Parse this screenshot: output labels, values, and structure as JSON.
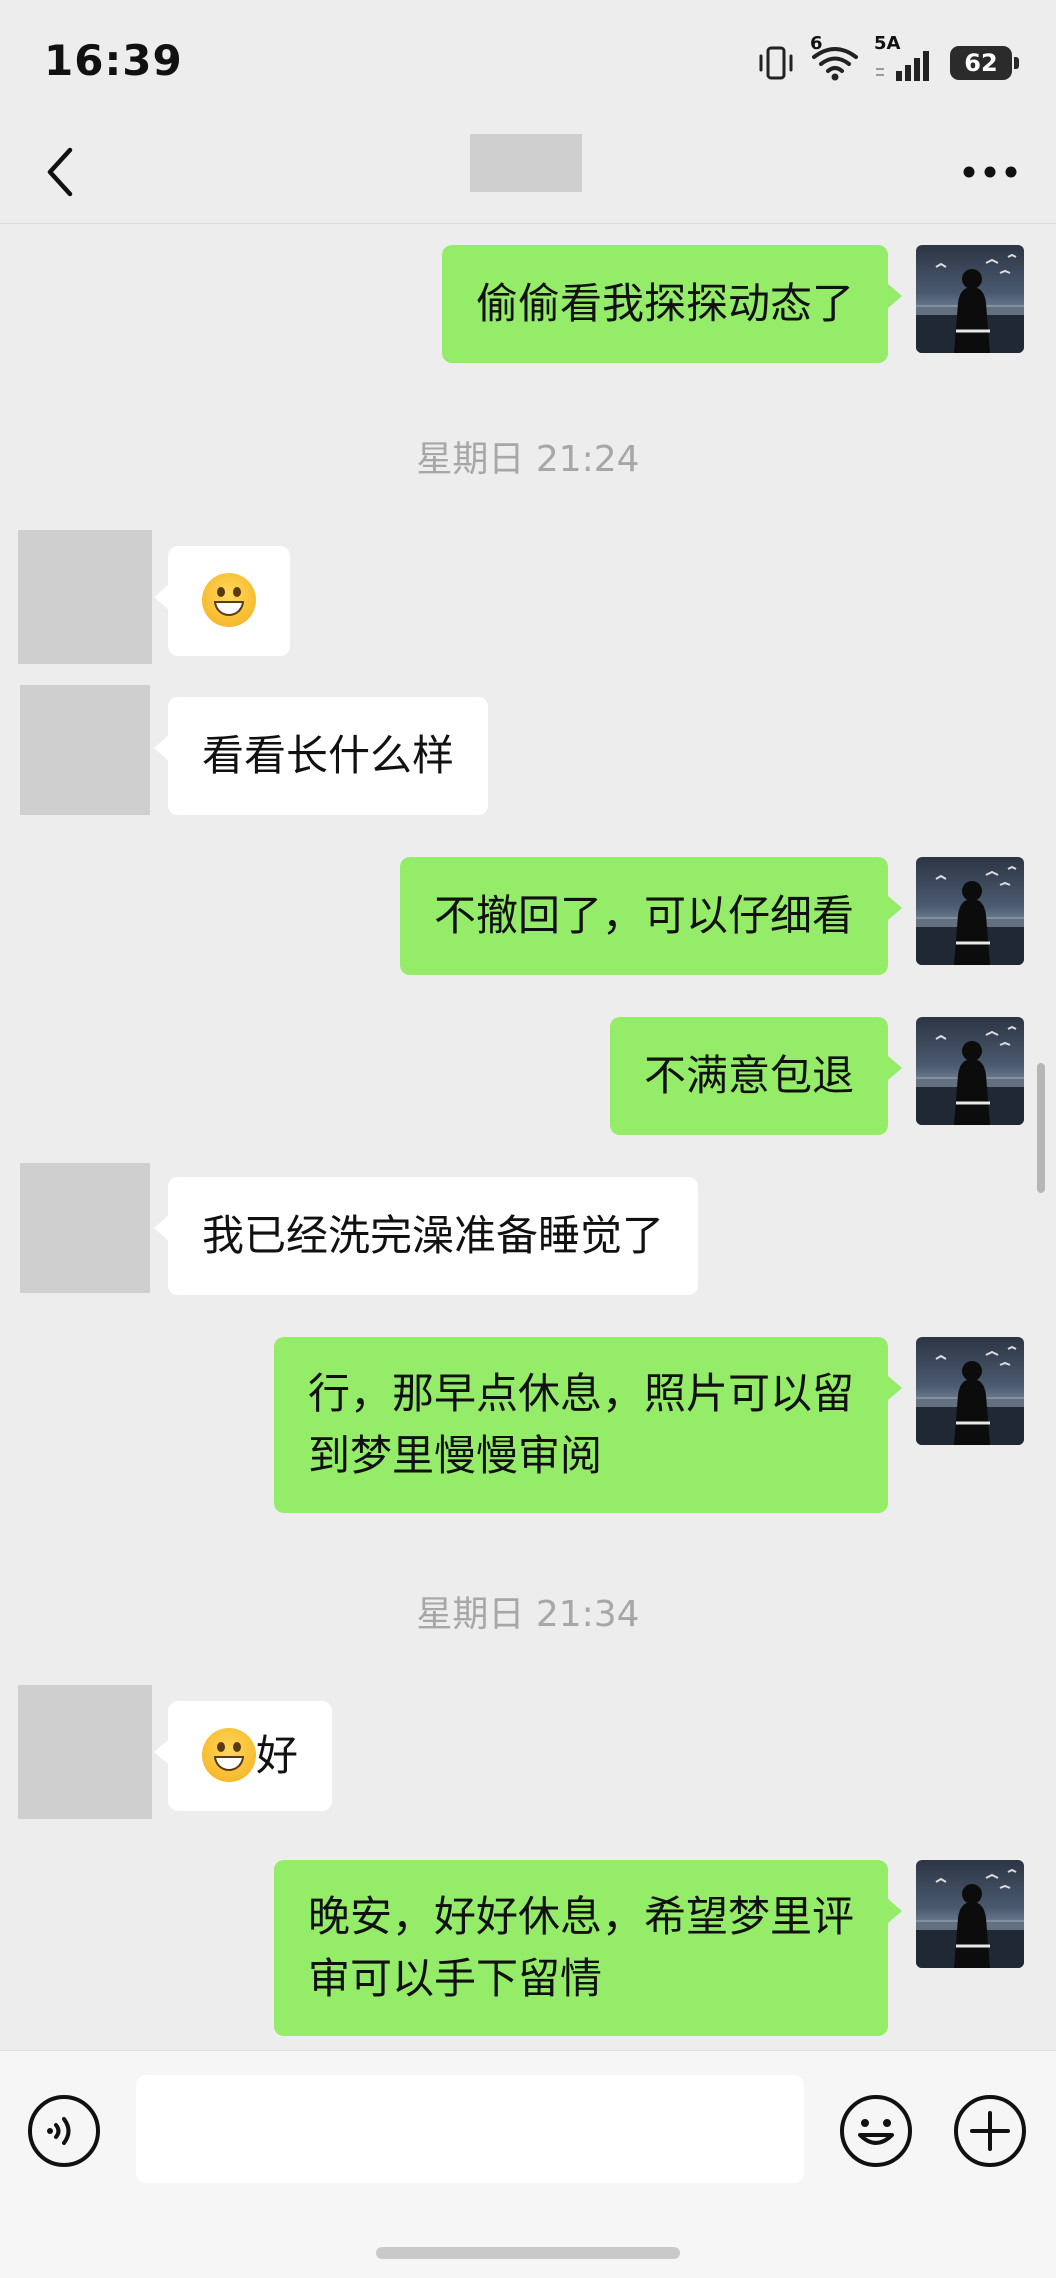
{
  "status_bar": {
    "time": "16:39",
    "wifi_badge": "6",
    "network": "5A",
    "battery": "62"
  },
  "nav": {
    "back_icon": "chevron-left-icon",
    "more_icon": "more-dots-icon"
  },
  "messages": {
    "m1": "偷偷看我探探动态了",
    "sep1": "星期日 21:24",
    "m3": "看看长什么样",
    "m4": "不撤回了，可以仔细看",
    "m5": "不满意包退",
    "m6": "我已经洗完澡准备睡觉了",
    "m7_line1": "行，那早点休息，照片可以留",
    "m7_line2": "到梦里慢慢审阅",
    "sep2": "星期日 21:34",
    "m8_text": "好",
    "m9_line1": "晚安，好好休息，希望梦里评",
    "m9_line2": "审可以手下留情"
  },
  "input_bar": {
    "voice_icon": "voice-icon",
    "emoji_icon": "smiley-icon",
    "plus_icon": "plus-circle-icon",
    "value": "",
    "placeholder": ""
  },
  "colors": {
    "background": "#ededed",
    "my_bubble": "#95ec69",
    "other_bubble": "#ffffff",
    "timestamp": "#a7a7a7"
  }
}
